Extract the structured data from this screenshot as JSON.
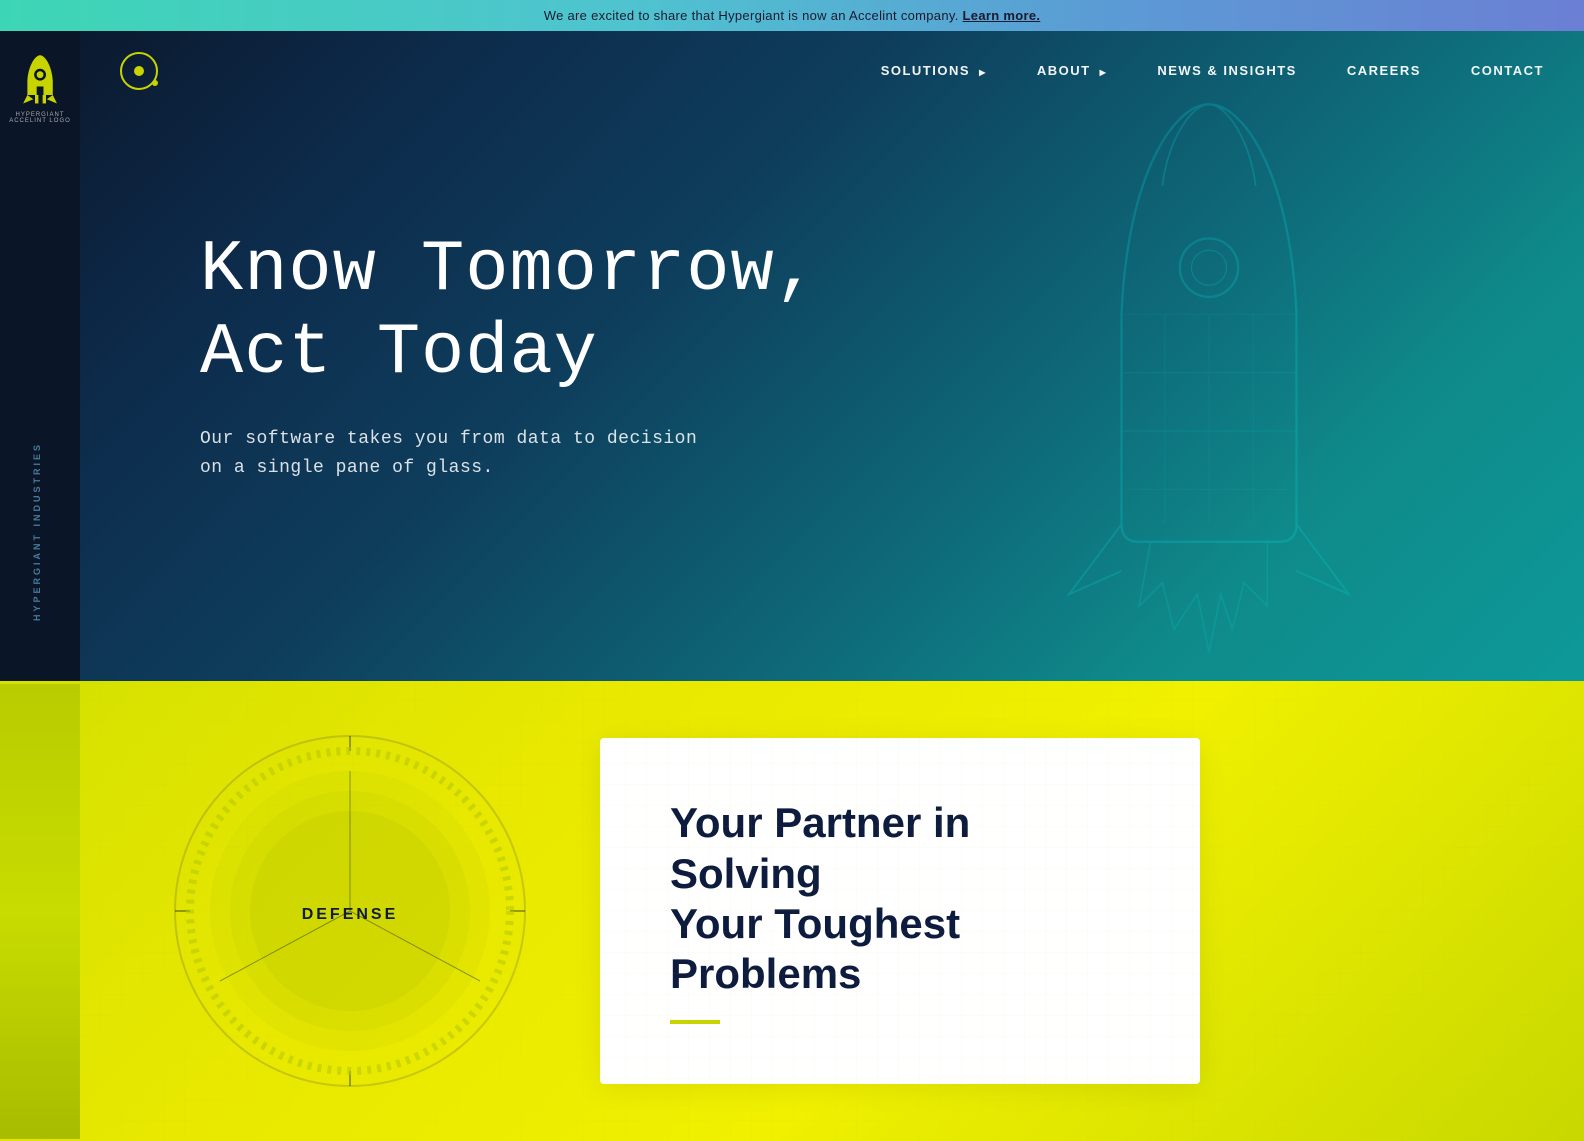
{
  "announcement": {
    "text": "We are excited to share that Hypergiant is now an Accelint company.",
    "link_text": "Learn more.",
    "link_url": "#"
  },
  "nav": {
    "logo_aria": "Hypergiant Accelint Logo",
    "links": [
      {
        "id": "solutions",
        "label": "SOLUTIONS",
        "has_dropdown": true
      },
      {
        "id": "about",
        "label": "ABOUT",
        "has_dropdown": true
      },
      {
        "id": "news",
        "label": "NEWS & INSIGHTS",
        "has_dropdown": false
      },
      {
        "id": "careers",
        "label": "CAREERS",
        "has_dropdown": false
      },
      {
        "id": "contact",
        "label": "CONTACT",
        "has_dropdown": false
      }
    ]
  },
  "hero": {
    "title_line1": "Know Tomorrow,",
    "title_line2": "Act Today",
    "subtitle": "Our software takes you from data to decision\non a single pane of glass."
  },
  "sidebar": {
    "vertical_label": "HYPERGIANT INDUSTRIES"
  },
  "yellow_section": {
    "dial_label": "DEFENSE",
    "card_title_line1": "Your Partner in Solving",
    "card_title_line2": "Your Toughest Problems"
  }
}
